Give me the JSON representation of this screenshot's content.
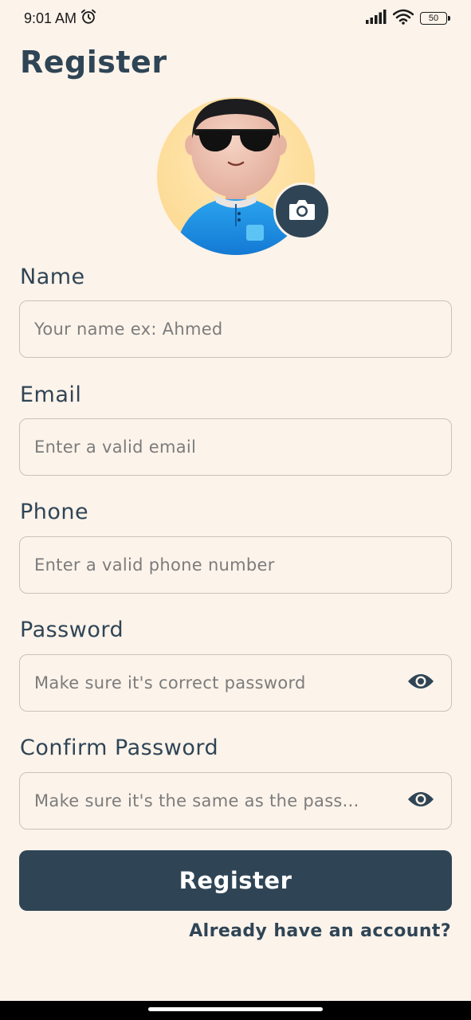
{
  "status_bar": {
    "time": "9:01 AM",
    "battery": "50"
  },
  "header": {
    "title": "Register"
  },
  "avatar": {
    "icon": "user-avatar",
    "camera_icon": "camera-icon"
  },
  "form": {
    "name": {
      "label": "Name",
      "placeholder": "Your name ex: Ahmed"
    },
    "email": {
      "label": "Email",
      "placeholder": "Enter a valid email"
    },
    "phone": {
      "label": "Phone",
      "placeholder": "Enter a valid phone number"
    },
    "password": {
      "label": "Password",
      "placeholder": "Make sure it's correct password",
      "toggle_icon": "eye-icon"
    },
    "confirm_password": {
      "label": "Confirm Password",
      "placeholder": "Make sure it's the same as the pass...",
      "toggle_icon": "eye-icon"
    }
  },
  "actions": {
    "register_label": "Register",
    "login_link": "Already have an account?"
  },
  "colors": {
    "background": "#fcf3ea",
    "primary": "#2f4556"
  }
}
